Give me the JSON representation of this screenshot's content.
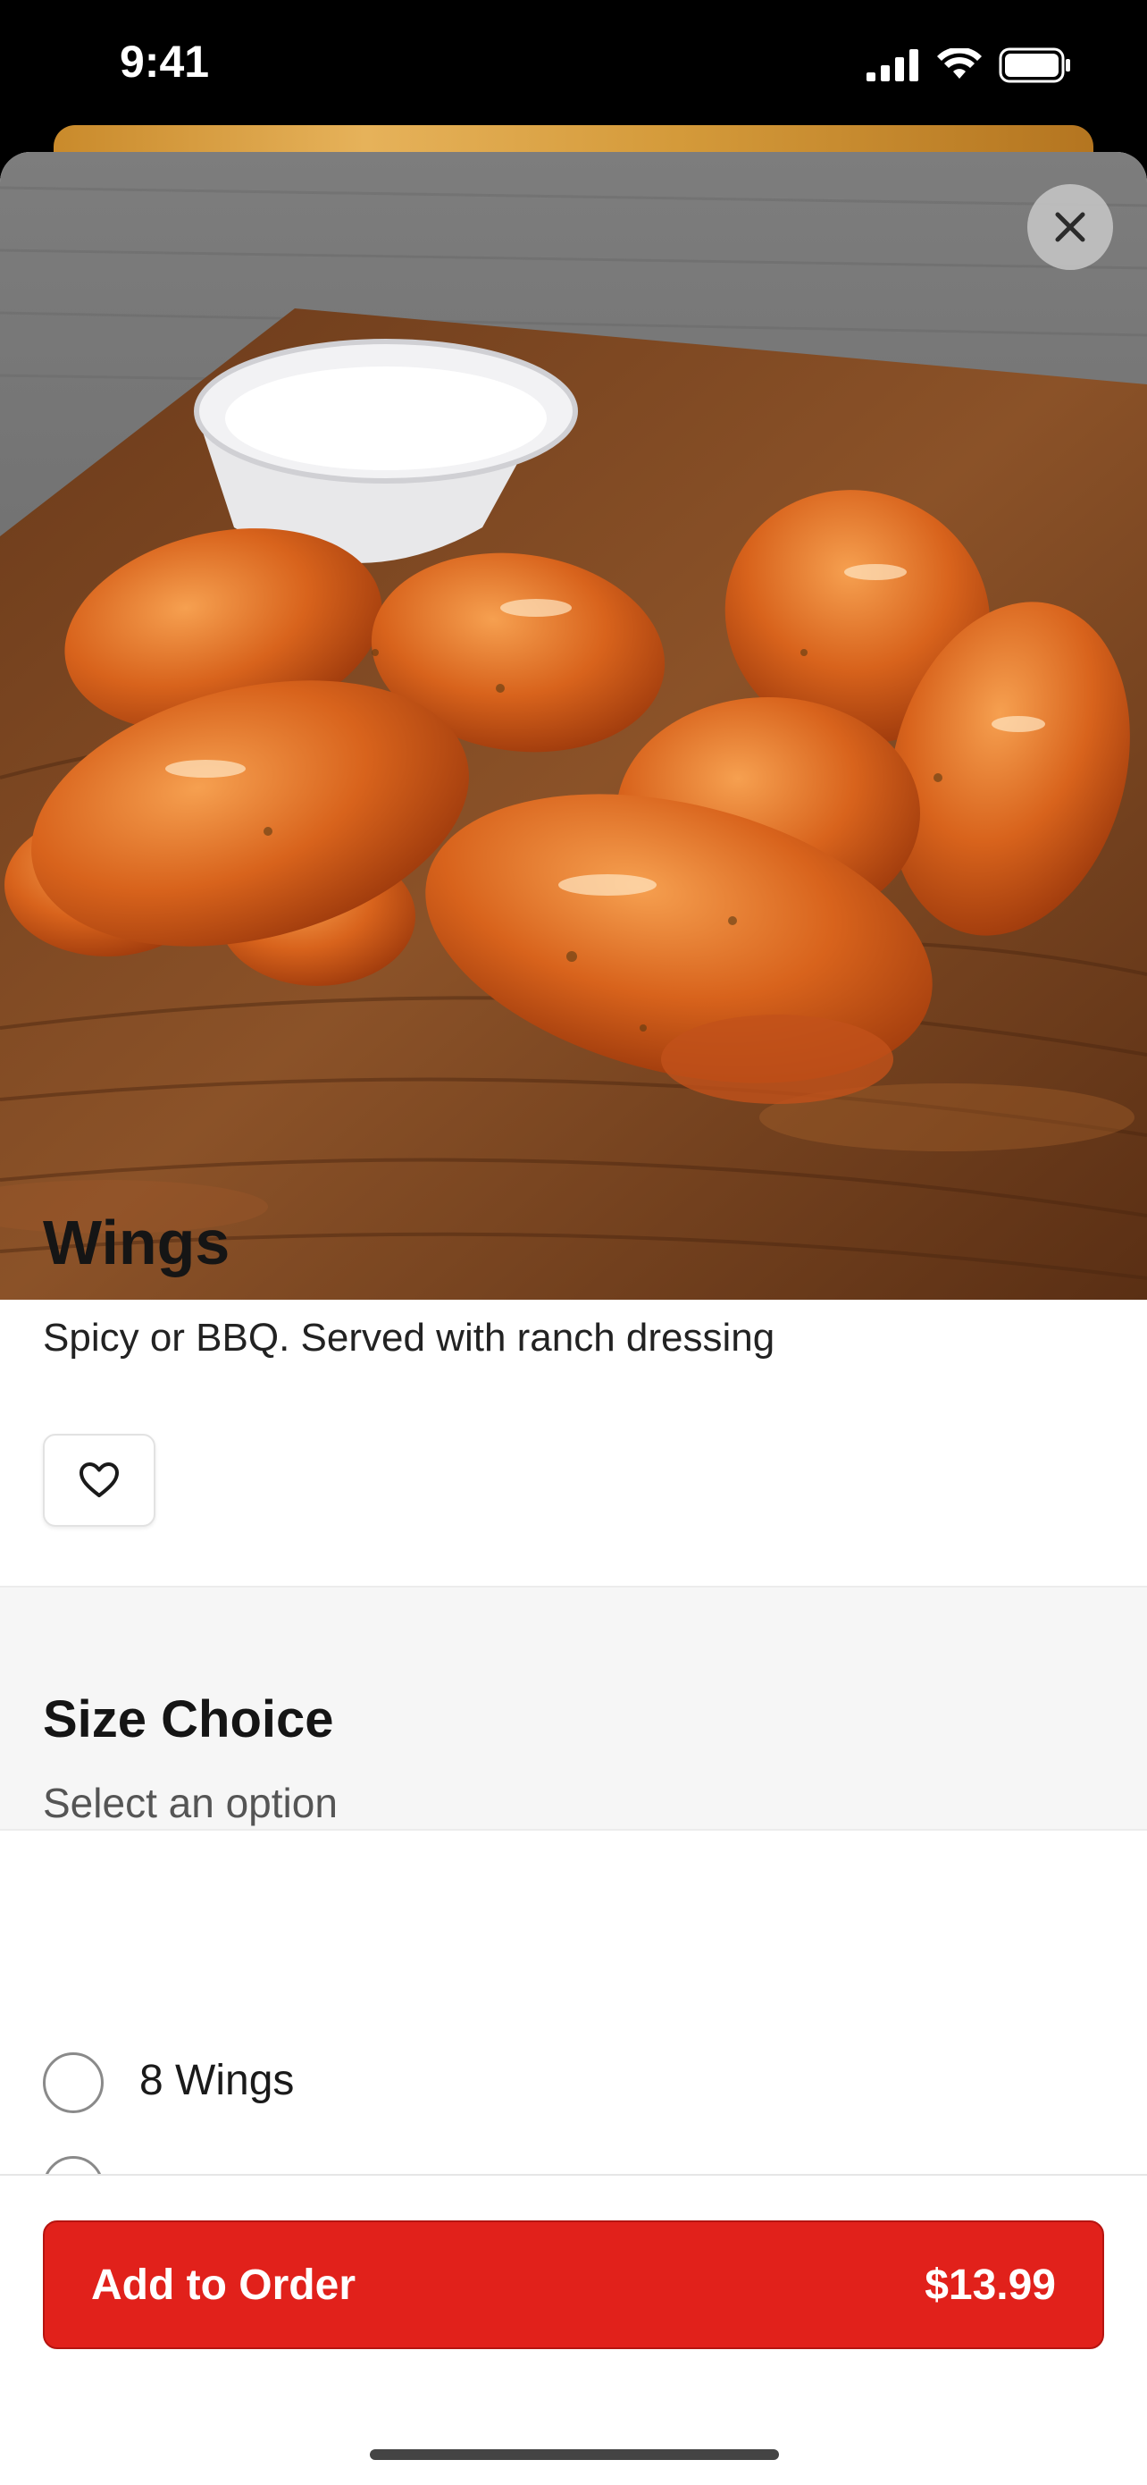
{
  "status_bar": {
    "time": "9:41"
  },
  "product": {
    "name": "Wings",
    "description": "Spicy or BBQ. Served with ranch dressing"
  },
  "size_choice": {
    "title": "Size Choice",
    "subtitle": "Select an option",
    "options": [
      {
        "label": "8 Wings"
      }
    ]
  },
  "footer": {
    "add_label": "Add to Order",
    "price": "$13.99"
  },
  "colors": {
    "accent": "#e1211b"
  },
  "icons": {
    "close": "close-icon",
    "favorite": "heart-icon"
  }
}
